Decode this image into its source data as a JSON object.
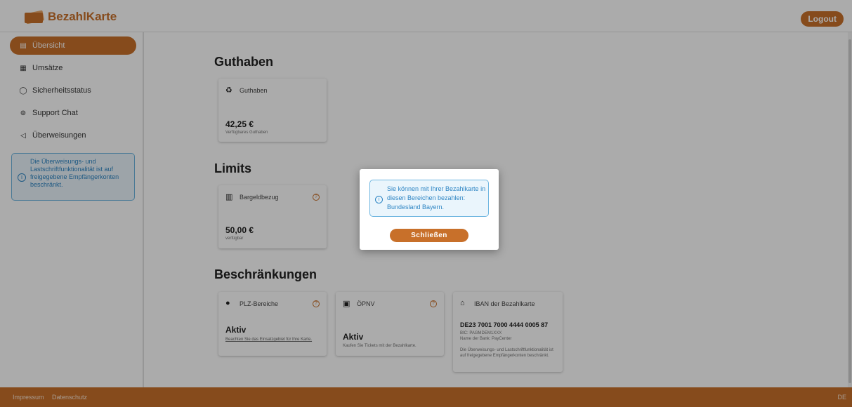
{
  "header": {
    "brand": "BezahlKarte",
    "logout_label": "Logout"
  },
  "sidebar": {
    "items": [
      {
        "label": "Übersicht",
        "icon": "dashboard-icon"
      },
      {
        "label": "Umsätze",
        "icon": "receipt-icon"
      },
      {
        "label": "Sicherheitsstatus",
        "icon": "shield-icon"
      },
      {
        "label": "Support Chat",
        "icon": "help-icon"
      },
      {
        "label": "Überweisungen",
        "icon": "send-icon"
      }
    ],
    "info": "Die Überweisungs- und Lastschriftfunktionalität ist auf freigegebene Empfängerkonten beschränkt."
  },
  "main": {
    "guthaben": {
      "heading": "Guthaben",
      "card_title": "Guthaben",
      "amount": "42,25 €",
      "caption": "Verfügbares Guthaben"
    },
    "limits": {
      "heading": "Limits",
      "card_title": "Bargeldbezug",
      "amount": "50,00 €",
      "caption": "verfügbar"
    },
    "beschraenkungen": {
      "heading": "Beschränkungen",
      "plz": {
        "title": "PLZ-Bereiche",
        "status": "Aktiv",
        "link": "Beachten Sie das Einsatzgebiet für Ihre Karte."
      },
      "oepnv": {
        "title": "ÖPNV",
        "status": "Aktiv",
        "caption": "Kaufen Sie Tickets mit der Bezahlkarte."
      },
      "iban": {
        "title": "IBAN der Bezahlkarte",
        "iban": "DE23 7001 7000 4444 0005 87",
        "bic": "BIC: PAGMDEM1XXX",
        "bank": "Name der Bank: PayCenter",
        "note": "Die Überweisungs- und Lastschriftfunktionalität ist auf freigegebene Empfängerkonten beschränkt."
      }
    }
  },
  "footer": {
    "impressum": "Impressum",
    "datenschutz": "Datenschutz",
    "language": "DE"
  },
  "modal": {
    "message": "Sie können mit Ihrer Bezahlkarte in diesen Bereichen bezahlen: Bundesland Bayern.",
    "close_label": "Schließen"
  },
  "colors": {
    "accent": "#c8702a",
    "info": "#2f86c4"
  }
}
